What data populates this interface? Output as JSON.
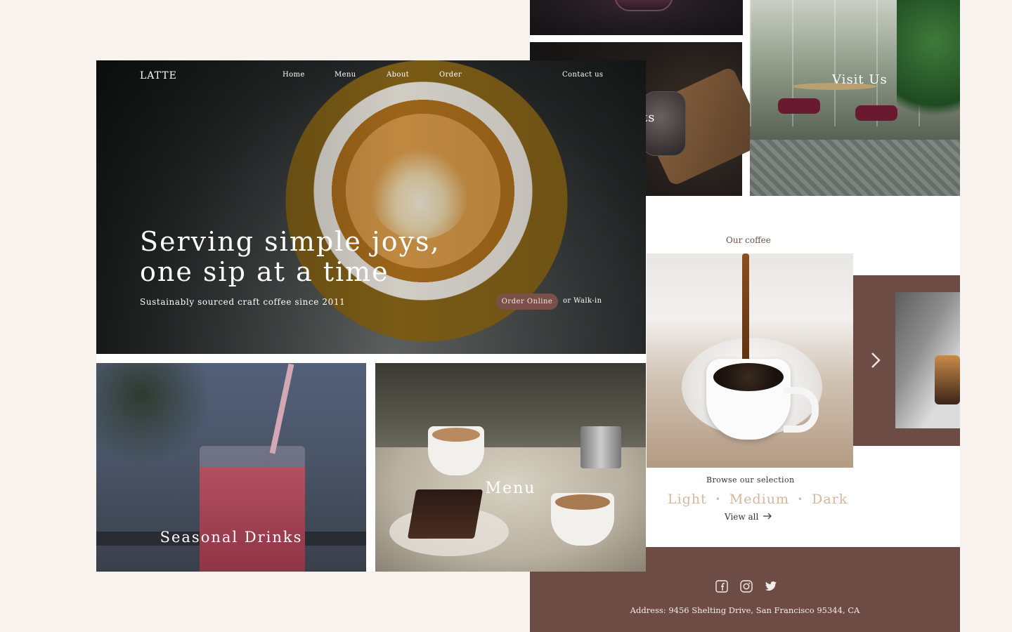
{
  "back": {
    "tiles": {
      "desserts_partial_label": "ts",
      "visit_label": "Visit Us"
    },
    "our_coffee_label": "Our coffee",
    "browse_label": "Browse our selection",
    "roasts": [
      "Light",
      "Medium",
      "Dark"
    ],
    "roast_separator": "•",
    "view_all": "View all",
    "view_all_icon": "arrow-right-icon",
    "carousel_next_icon": "chevron-right-icon",
    "footer": {
      "social_icons": [
        "facebook-icon",
        "instagram-icon",
        "twitter-icon"
      ],
      "address": "Address: 9456 Shelting Drive, San Francisco 95344, CA"
    }
  },
  "front": {
    "logo": "LATTE",
    "nav": {
      "home": "Home",
      "menu": "Menu",
      "about": "About",
      "order": "Order",
      "contact": "Contact us"
    },
    "hero": {
      "title_line1": "Serving simple joys,",
      "title_line2": "one sip at a time",
      "subtitle": "Sustainably sourced craft coffee since 2011",
      "cta": "Order Online",
      "cta_alt": "or Walk-in"
    },
    "tiles": {
      "seasonal": "Seasonal Drinks",
      "menu": "Menu"
    }
  },
  "colors": {
    "background": "#f8f3ef",
    "accent_brown": "#6d4c46",
    "button_brown": "#7a5048",
    "roast_text": "#d6b79c"
  }
}
